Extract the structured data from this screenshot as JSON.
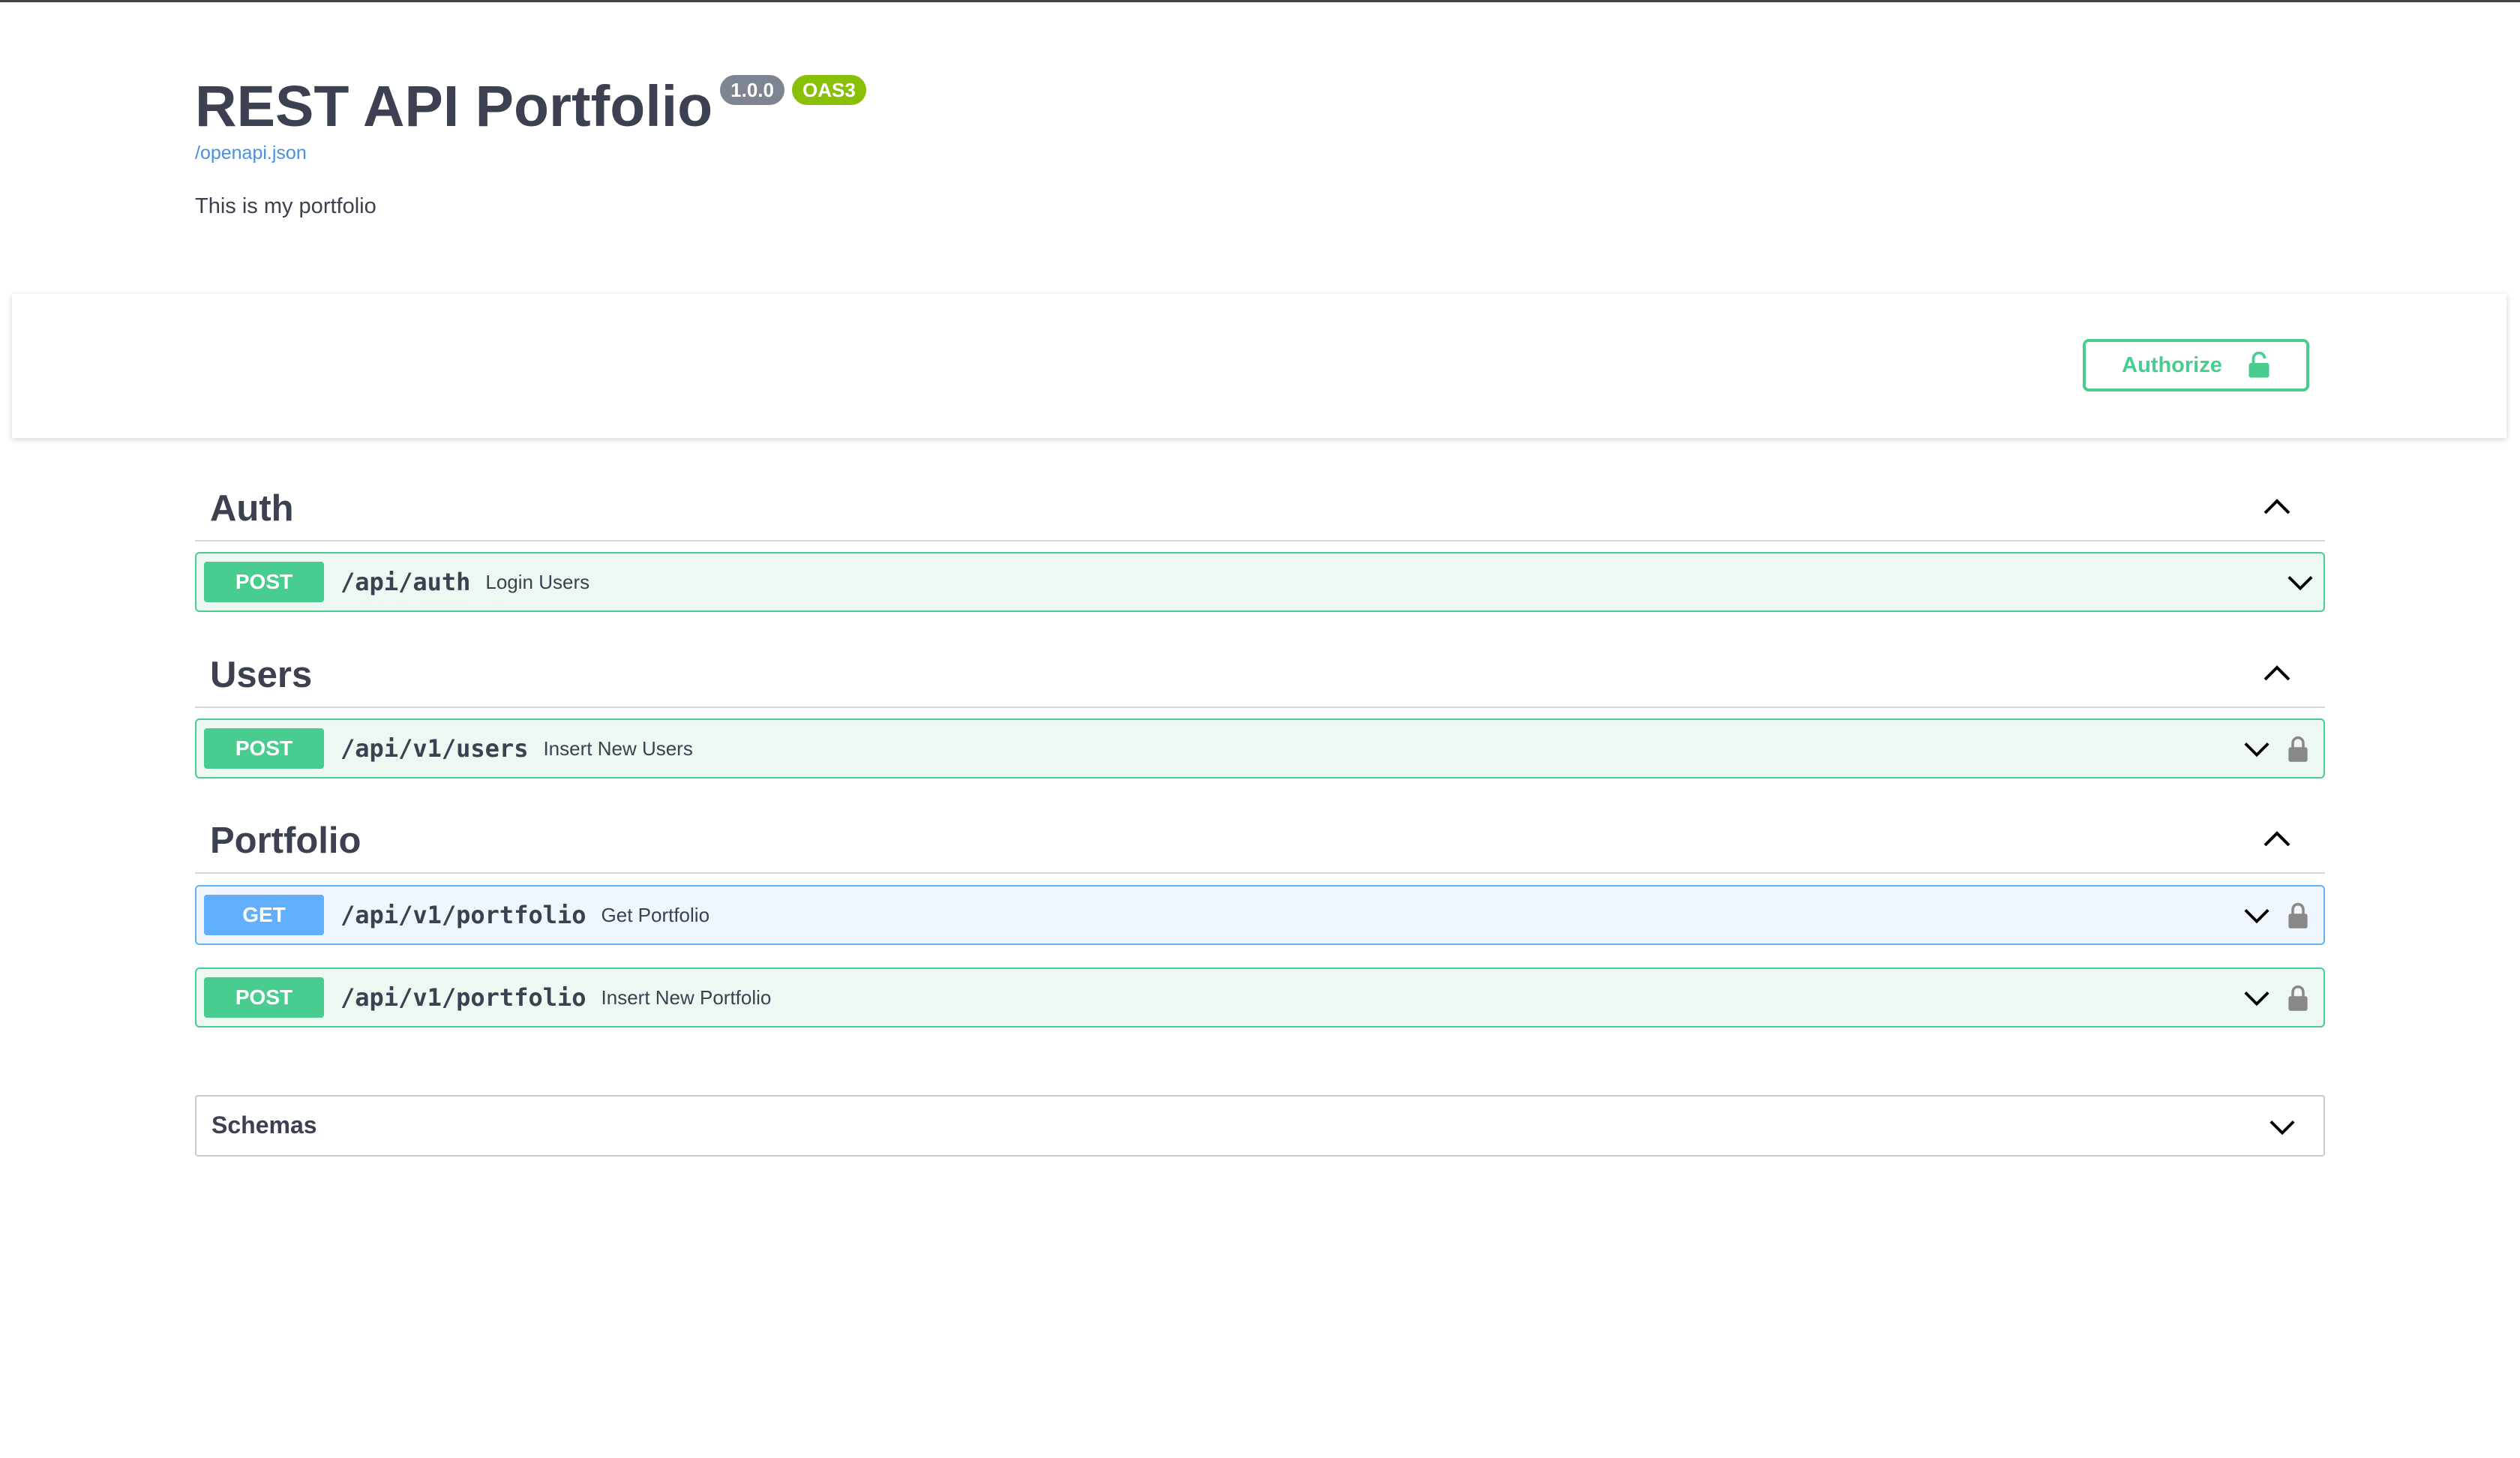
{
  "info": {
    "title": "REST API Portfolio",
    "version": "1.0.0",
    "oas_badge": "OAS3",
    "spec_url": "/openapi.json",
    "description": "This is my portfolio"
  },
  "authorize": {
    "label": "Authorize",
    "icon": "unlock-icon",
    "color": "#49cc90"
  },
  "tags": [
    {
      "name": "Auth",
      "operations": [
        {
          "method": "POST",
          "path": "/api/auth",
          "summary": "Login Users",
          "locked": false
        }
      ]
    },
    {
      "name": "Users",
      "operations": [
        {
          "method": "POST",
          "path": "/api/v1/users",
          "summary": "Insert New Users",
          "locked": true
        }
      ]
    },
    {
      "name": "Portfolio",
      "operations": [
        {
          "method": "GET",
          "path": "/api/v1/portfolio",
          "summary": "Get Portfolio",
          "locked": true
        },
        {
          "method": "POST",
          "path": "/api/v1/portfolio",
          "summary": "Insert New Portfolio",
          "locked": true
        }
      ]
    }
  ],
  "schemas": {
    "label": "Schemas"
  },
  "colors": {
    "post": "#49cc90",
    "get": "#61affe",
    "text": "#3b4151"
  }
}
